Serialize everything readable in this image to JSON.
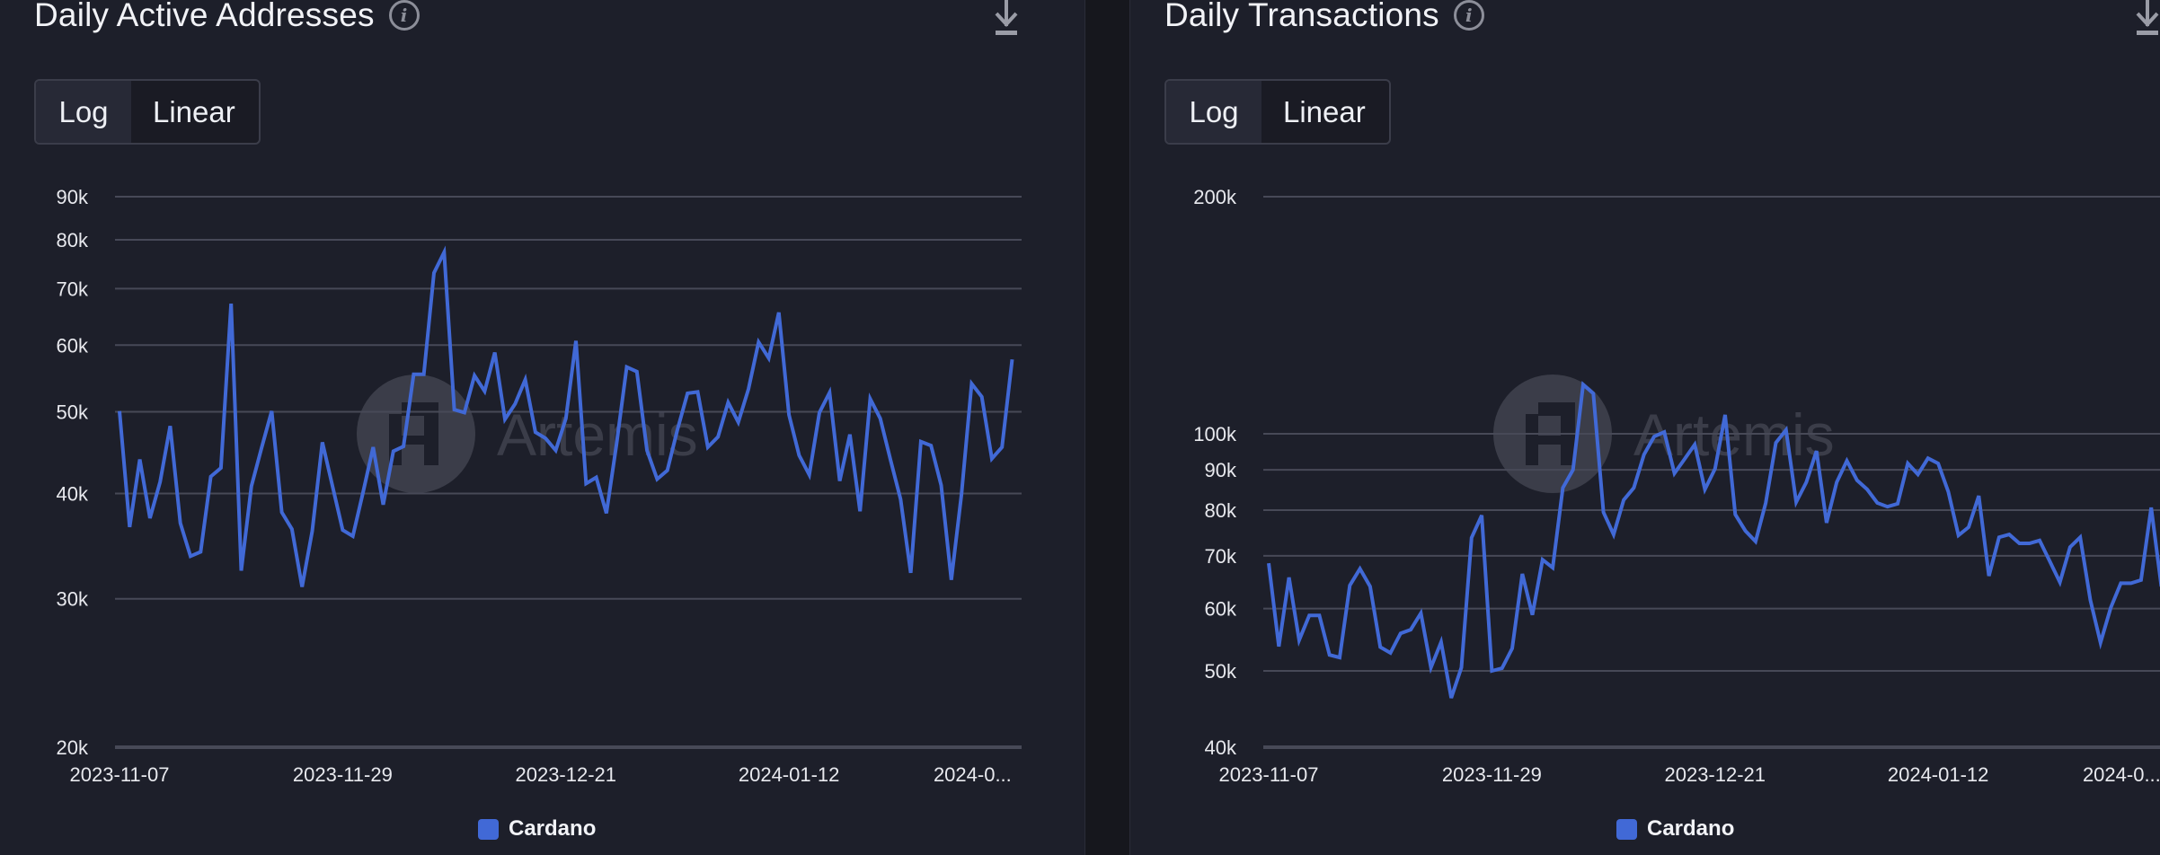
{
  "colors": {
    "series": "#4169d6",
    "grid": "#474957",
    "axis_text": "#e8e9ee",
    "watermark": "#8a8d99"
  },
  "panels": [
    {
      "title": "Daily Active Addresses",
      "info_icon": "info-icon",
      "download_icon": "download-icon",
      "scale_toggle": {
        "options": [
          "Log",
          "Linear"
        ],
        "selected": "Log"
      },
      "watermark": "Artemis",
      "legend": [
        {
          "label": "Cardano",
          "color": "#4169d6"
        }
      ]
    },
    {
      "title": "Daily Transactions",
      "info_icon": "info-icon",
      "download_icon": "download-icon",
      "scale_toggle": {
        "options": [
          "Log",
          "Linear"
        ],
        "selected": "Log"
      },
      "watermark": "Artemis",
      "legend": [
        {
          "label": "Cardano",
          "color": "#4169d6"
        }
      ]
    }
  ],
  "chart_data": [
    {
      "type": "line",
      "title": "Daily Active Addresses",
      "xlabel": "",
      "ylabel": "",
      "yscale": "log",
      "ylim": [
        20000,
        90000
      ],
      "yticks": [
        20000,
        30000,
        40000,
        50000,
        60000,
        70000,
        80000,
        90000
      ],
      "ytick_labels": [
        "20k",
        "30k",
        "40k",
        "50k",
        "60k",
        "70k",
        "80k",
        "90k"
      ],
      "x_start": "2023-11-07",
      "x_end": "2024-02-03",
      "xtick_labels": [
        "2023-11-07",
        "2023-11-29",
        "2023-12-21",
        "2024-01-12",
        "2024-0..."
      ],
      "xtick_index": [
        0,
        22,
        44,
        66,
        84
      ],
      "grid": true,
      "legend_position": "bottom-center",
      "series": [
        {
          "name": "Cardano",
          "values": [
            50100,
            36500,
            43900,
            37400,
            41300,
            48100,
            36900,
            33700,
            34100,
            41900,
            42900,
            67200,
            32400,
            40800,
            45300,
            50100,
            38000,
            36300,
            31000,
            36100,
            46000,
            40800,
            36200,
            35600,
            40100,
            45400,
            38800,
            44900,
            45500,
            55400,
            55400,
            73100,
            77300,
            50300,
            49900,
            55200,
            52900,
            58800,
            49000,
            51100,
            54600,
            47300,
            46500,
            45000,
            49100,
            60700,
            41100,
            41800,
            37900,
            45800,
            56500,
            55800,
            45000,
            41600,
            42600,
            47600,
            52600,
            52800,
            45400,
            46700,
            51300,
            48600,
            53200,
            60500,
            57900,
            65600,
            49600,
            44400,
            42100,
            49900,
            52700,
            41400,
            47000,
            38100,
            51800,
            49100,
            43900,
            39400,
            32200,
            46100,
            45600,
            40900,
            31600,
            39900,
            54000,
            52100,
            44000,
            45400,
            57700
          ]
        }
      ]
    },
    {
      "type": "line",
      "title": "Daily Transactions",
      "xlabel": "",
      "ylabel": "",
      "yscale": "log",
      "ylim": [
        40000,
        200000
      ],
      "yticks": [
        40000,
        50000,
        60000,
        70000,
        80000,
        90000,
        100000,
        200000
      ],
      "ytick_labels": [
        "40k",
        "50k",
        "60k",
        "70k",
        "80k",
        "90k",
        "100k",
        "200k"
      ],
      "x_start": "2023-11-07",
      "x_end": "2024-02-03",
      "xtick_labels": [
        "2023-11-07",
        "2023-11-29",
        "2023-12-21",
        "2024-01-12",
        "2024-0..."
      ],
      "xtick_index": [
        0,
        22,
        44,
        66,
        84
      ],
      "grid": true,
      "legend_position": "bottom-center",
      "series": [
        {
          "name": "Cardano",
          "values": [
            68500,
            53700,
            65700,
            54700,
            58800,
            58800,
            52400,
            52000,
            64200,
            67400,
            64000,
            53600,
            52700,
            55800,
            56400,
            59200,
            50500,
            54400,
            46200,
            50500,
            73800,
            78800,
            50000,
            50400,
            53400,
            66400,
            58900,
            69200,
            67600,
            85400,
            90000,
            115500,
            112500,
            79500,
            74500,
            82400,
            85400,
            94100,
            99200,
            100500,
            89100,
            92900,
            96900,
            85000,
            90300,
            105700,
            79000,
            75300,
            73000,
            81700,
            97400,
            101100,
            81900,
            86800,
            95100,
            77100,
            86800,
            92400,
            87300,
            85000,
            81700,
            80800,
            81500,
            91700,
            88800,
            93100,
            91700,
            84400,
            74300,
            76100,
            83400,
            66000,
            73900,
            74500,
            72600,
            72600,
            73200,
            68900,
            64800,
            71800,
            73900,
            61500,
            54300,
            60100,
            64600,
            64600,
            65200,
            80600,
            64000
          ]
        }
      ]
    }
  ]
}
